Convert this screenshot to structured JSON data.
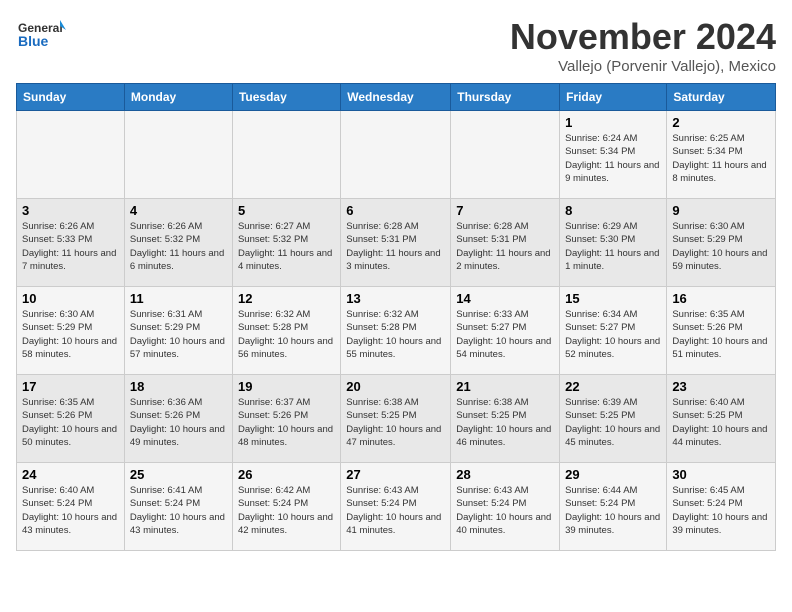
{
  "logo": {
    "line1": "General",
    "line2": "Blue"
  },
  "title": "November 2024",
  "subtitle": "Vallejo (Porvenir Vallejo), Mexico",
  "weekdays": [
    "Sunday",
    "Monday",
    "Tuesday",
    "Wednesday",
    "Thursday",
    "Friday",
    "Saturday"
  ],
  "weeks": [
    [
      {
        "day": "",
        "info": ""
      },
      {
        "day": "",
        "info": ""
      },
      {
        "day": "",
        "info": ""
      },
      {
        "day": "",
        "info": ""
      },
      {
        "day": "",
        "info": ""
      },
      {
        "day": "1",
        "info": "Sunrise: 6:24 AM\nSunset: 5:34 PM\nDaylight: 11 hours and 9 minutes."
      },
      {
        "day": "2",
        "info": "Sunrise: 6:25 AM\nSunset: 5:34 PM\nDaylight: 11 hours and 8 minutes."
      }
    ],
    [
      {
        "day": "3",
        "info": "Sunrise: 6:26 AM\nSunset: 5:33 PM\nDaylight: 11 hours and 7 minutes."
      },
      {
        "day": "4",
        "info": "Sunrise: 6:26 AM\nSunset: 5:32 PM\nDaylight: 11 hours and 6 minutes."
      },
      {
        "day": "5",
        "info": "Sunrise: 6:27 AM\nSunset: 5:32 PM\nDaylight: 11 hours and 4 minutes."
      },
      {
        "day": "6",
        "info": "Sunrise: 6:28 AM\nSunset: 5:31 PM\nDaylight: 11 hours and 3 minutes."
      },
      {
        "day": "7",
        "info": "Sunrise: 6:28 AM\nSunset: 5:31 PM\nDaylight: 11 hours and 2 minutes."
      },
      {
        "day": "8",
        "info": "Sunrise: 6:29 AM\nSunset: 5:30 PM\nDaylight: 11 hours and 1 minute."
      },
      {
        "day": "9",
        "info": "Sunrise: 6:30 AM\nSunset: 5:29 PM\nDaylight: 10 hours and 59 minutes."
      }
    ],
    [
      {
        "day": "10",
        "info": "Sunrise: 6:30 AM\nSunset: 5:29 PM\nDaylight: 10 hours and 58 minutes."
      },
      {
        "day": "11",
        "info": "Sunrise: 6:31 AM\nSunset: 5:29 PM\nDaylight: 10 hours and 57 minutes."
      },
      {
        "day": "12",
        "info": "Sunrise: 6:32 AM\nSunset: 5:28 PM\nDaylight: 10 hours and 56 minutes."
      },
      {
        "day": "13",
        "info": "Sunrise: 6:32 AM\nSunset: 5:28 PM\nDaylight: 10 hours and 55 minutes."
      },
      {
        "day": "14",
        "info": "Sunrise: 6:33 AM\nSunset: 5:27 PM\nDaylight: 10 hours and 54 minutes."
      },
      {
        "day": "15",
        "info": "Sunrise: 6:34 AM\nSunset: 5:27 PM\nDaylight: 10 hours and 52 minutes."
      },
      {
        "day": "16",
        "info": "Sunrise: 6:35 AM\nSunset: 5:26 PM\nDaylight: 10 hours and 51 minutes."
      }
    ],
    [
      {
        "day": "17",
        "info": "Sunrise: 6:35 AM\nSunset: 5:26 PM\nDaylight: 10 hours and 50 minutes."
      },
      {
        "day": "18",
        "info": "Sunrise: 6:36 AM\nSunset: 5:26 PM\nDaylight: 10 hours and 49 minutes."
      },
      {
        "day": "19",
        "info": "Sunrise: 6:37 AM\nSunset: 5:26 PM\nDaylight: 10 hours and 48 minutes."
      },
      {
        "day": "20",
        "info": "Sunrise: 6:38 AM\nSunset: 5:25 PM\nDaylight: 10 hours and 47 minutes."
      },
      {
        "day": "21",
        "info": "Sunrise: 6:38 AM\nSunset: 5:25 PM\nDaylight: 10 hours and 46 minutes."
      },
      {
        "day": "22",
        "info": "Sunrise: 6:39 AM\nSunset: 5:25 PM\nDaylight: 10 hours and 45 minutes."
      },
      {
        "day": "23",
        "info": "Sunrise: 6:40 AM\nSunset: 5:25 PM\nDaylight: 10 hours and 44 minutes."
      }
    ],
    [
      {
        "day": "24",
        "info": "Sunrise: 6:40 AM\nSunset: 5:24 PM\nDaylight: 10 hours and 43 minutes."
      },
      {
        "day": "25",
        "info": "Sunrise: 6:41 AM\nSunset: 5:24 PM\nDaylight: 10 hours and 43 minutes."
      },
      {
        "day": "26",
        "info": "Sunrise: 6:42 AM\nSunset: 5:24 PM\nDaylight: 10 hours and 42 minutes."
      },
      {
        "day": "27",
        "info": "Sunrise: 6:43 AM\nSunset: 5:24 PM\nDaylight: 10 hours and 41 minutes."
      },
      {
        "day": "28",
        "info": "Sunrise: 6:43 AM\nSunset: 5:24 PM\nDaylight: 10 hours and 40 minutes."
      },
      {
        "day": "29",
        "info": "Sunrise: 6:44 AM\nSunset: 5:24 PM\nDaylight: 10 hours and 39 minutes."
      },
      {
        "day": "30",
        "info": "Sunrise: 6:45 AM\nSunset: 5:24 PM\nDaylight: 10 hours and 39 minutes."
      }
    ]
  ]
}
